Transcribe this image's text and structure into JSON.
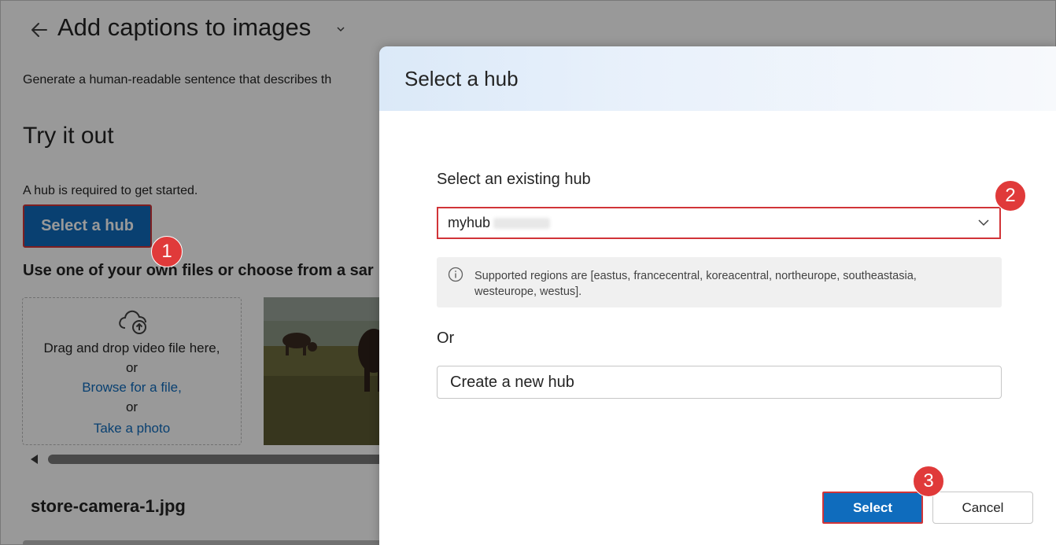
{
  "page": {
    "title": "Add captions to images",
    "description": "Generate a human-readable sentence that describes th",
    "try_heading": "Try it out",
    "hub_required_text": "A hub is required to get started.",
    "select_hub_button": "Select a hub",
    "use_files_text": "Use one of your own files or choose from a sar",
    "drop_zone": {
      "drag_text": "Drag and drop video file here,",
      "or_1": "or",
      "browse_link": "Browse for a file,",
      "or_2": "or",
      "photo_link": "Take a photo"
    },
    "file_name": "store-camera-1.jpg"
  },
  "dialog": {
    "title": "Select a hub",
    "existing_label": "Select an existing hub",
    "hub_value": "myhub",
    "info_text": "Supported regions are [eastus, francecentral, koreacentral, northeurope, southeastasia, westeurope, westus].",
    "or_label": "Or",
    "create_button": "Create a new hub",
    "select_button": "Select",
    "cancel_button": "Cancel"
  },
  "badges": [
    "1",
    "2",
    "3"
  ],
  "colors": {
    "accent": "#0f6cbd",
    "highlight": "#d13438",
    "badge": "#e03a3a"
  }
}
